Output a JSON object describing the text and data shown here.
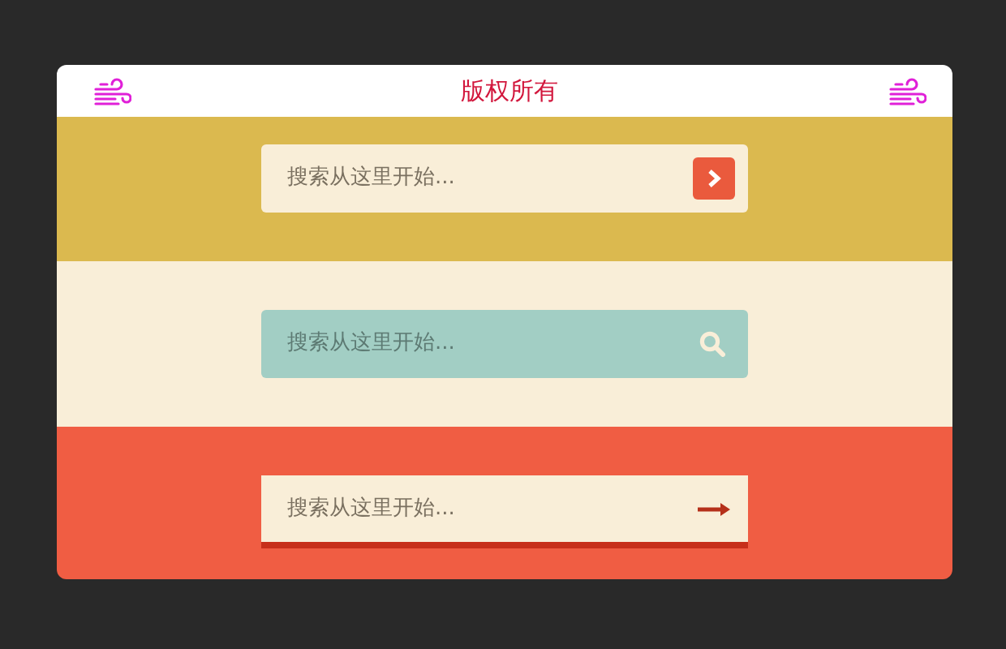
{
  "header": {
    "title": "版权所有"
  },
  "searches": [
    {
      "kind": "button-chevron",
      "placeholder": "搜索从这里开始..."
    },
    {
      "kind": "icon-search",
      "placeholder": "搜索从这里开始..."
    },
    {
      "kind": "arrow-underline",
      "placeholder": "搜索从这里开始..."
    }
  ]
}
